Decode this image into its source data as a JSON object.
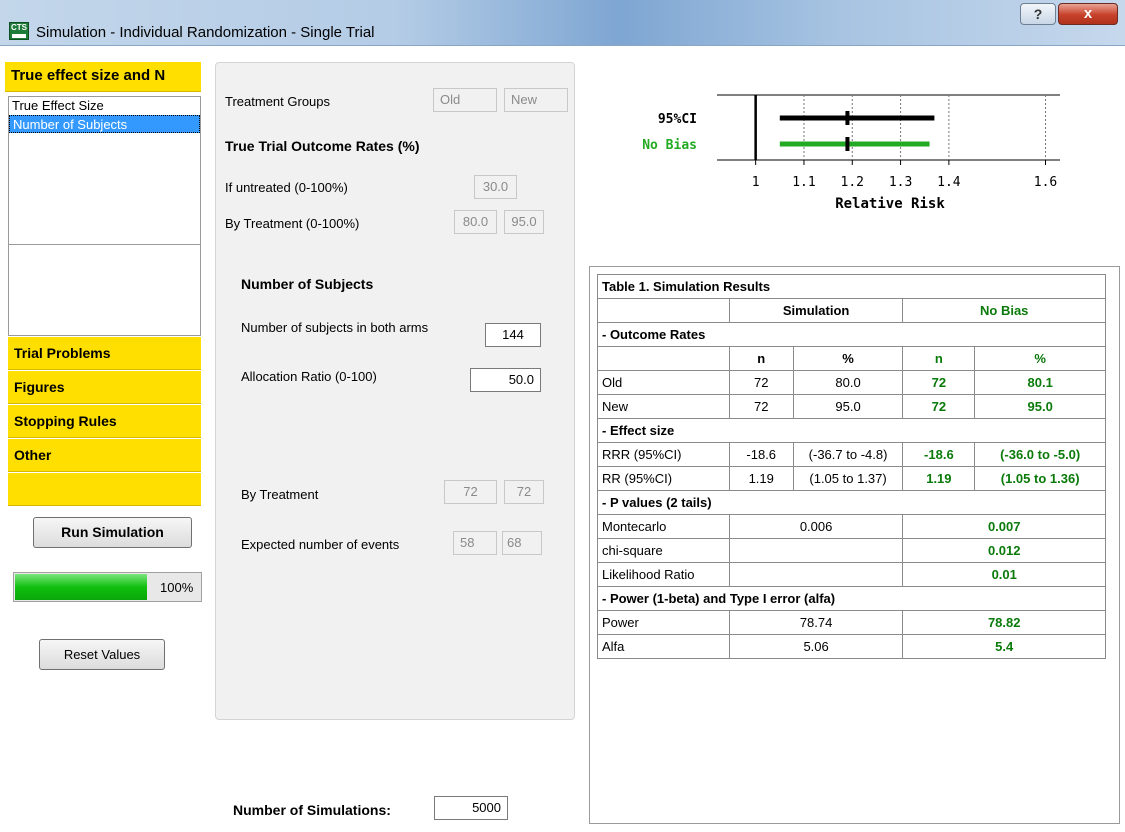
{
  "window": {
    "title": "Simulation - Individual Randomization - Single Trial",
    "app_icon_text": "CTS",
    "help_label": "?",
    "close_label": "x"
  },
  "sidebar": {
    "header": "True effect size and N",
    "items": [
      {
        "label": "True Effect Size",
        "selected": false
      },
      {
        "label": "Number of Subjects",
        "selected": true
      }
    ],
    "sections": [
      "Trial Problems",
      "Figures",
      "Stopping Rules",
      "Other"
    ],
    "run_label": "Run Simulation",
    "progress_text": "100%",
    "progress_value": 100,
    "reset_label": "Reset Values"
  },
  "middle": {
    "treatment_groups_label": "Treatment Groups",
    "group_old": "Old",
    "group_new": "New",
    "outcome_rates_title": "True Trial Outcome Rates (%)",
    "if_untreated_label": "If untreated (0-100%)",
    "if_untreated_value": "30.0",
    "by_treatment_rate_label": "By Treatment (0-100%)",
    "rate_old": "80.0",
    "rate_new": "95.0",
    "subjects_title": "Number of Subjects",
    "subjects_both_label": "Number of subjects in both arms",
    "subjects_both_value": "144",
    "allocation_label": "Allocation Ratio (0-100)",
    "allocation_value": "50.0",
    "by_treatment_label": "By Treatment",
    "n_old": "72",
    "n_new": "72",
    "expected_events_label": "Expected number of events",
    "events_old": "58",
    "events_new": "68",
    "num_sims_label": "Number of Simulations:",
    "num_sims_value": "5000"
  },
  "chart_data": {
    "type": "forest",
    "xlabel": "Relative Risk",
    "xticks": [
      1,
      1.1,
      1.2,
      1.3,
      1.4,
      1.6
    ],
    "xtick_labels": [
      "1",
      "1.1",
      "1.2",
      "1.3",
      "1.4",
      "1.6"
    ],
    "xlim": [
      0.92,
      1.63
    ],
    "reference_line": 1,
    "series": [
      {
        "name": "95%CI",
        "point": 1.19,
        "low": 1.05,
        "high": 1.37,
        "color": "#000000"
      },
      {
        "name": "No Bias",
        "point": 1.19,
        "low": 1.05,
        "high": 1.36,
        "color": "#22aa22"
      }
    ]
  },
  "results": {
    "title": "Table 1. Simulation Results",
    "col_simulation": "Simulation",
    "col_nobias": "No Bias",
    "sec_outcome": "- Outcome Rates",
    "h_n": "n",
    "h_pct": "%",
    "old": {
      "label": "Old",
      "sim_n": "72",
      "sim_pct": "80.0",
      "nb_n": "72",
      "nb_pct": "80.1"
    },
    "new": {
      "label": "New",
      "sim_n": "72",
      "sim_pct": "95.0",
      "nb_n": "72",
      "nb_pct": "95.0"
    },
    "sec_effect": "- Effect size",
    "rrr": {
      "label": "RRR (95%CI)",
      "sim_val": "-18.6",
      "sim_ci": "(-36.7 to -4.8)",
      "nb_val": "-18.6",
      "nb_ci": "(-36.0 to -5.0)"
    },
    "rr": {
      "label": "RR (95%CI)",
      "sim_val": "1.19",
      "sim_ci": "(1.05 to 1.37)",
      "nb_val": "1.19",
      "nb_ci": "(1.05 to 1.36)"
    },
    "sec_pvalues": "- P values (2 tails)",
    "montecarlo": {
      "label": "Montecarlo",
      "sim": "0.006",
      "nb": "0.007"
    },
    "chisq": {
      "label": "chi-square",
      "sim": "",
      "nb": "0.012"
    },
    "likelihood": {
      "label": "Likelihood Ratio",
      "sim": "",
      "nb": "0.01"
    },
    "sec_power": "- Power (1-beta) and Type I error (alfa)",
    "power": {
      "label": "Power",
      "sim": "78.74",
      "nb": "78.82"
    },
    "alfa": {
      "label": "Alfa",
      "sim": "5.06",
      "nb": "5.4"
    }
  }
}
